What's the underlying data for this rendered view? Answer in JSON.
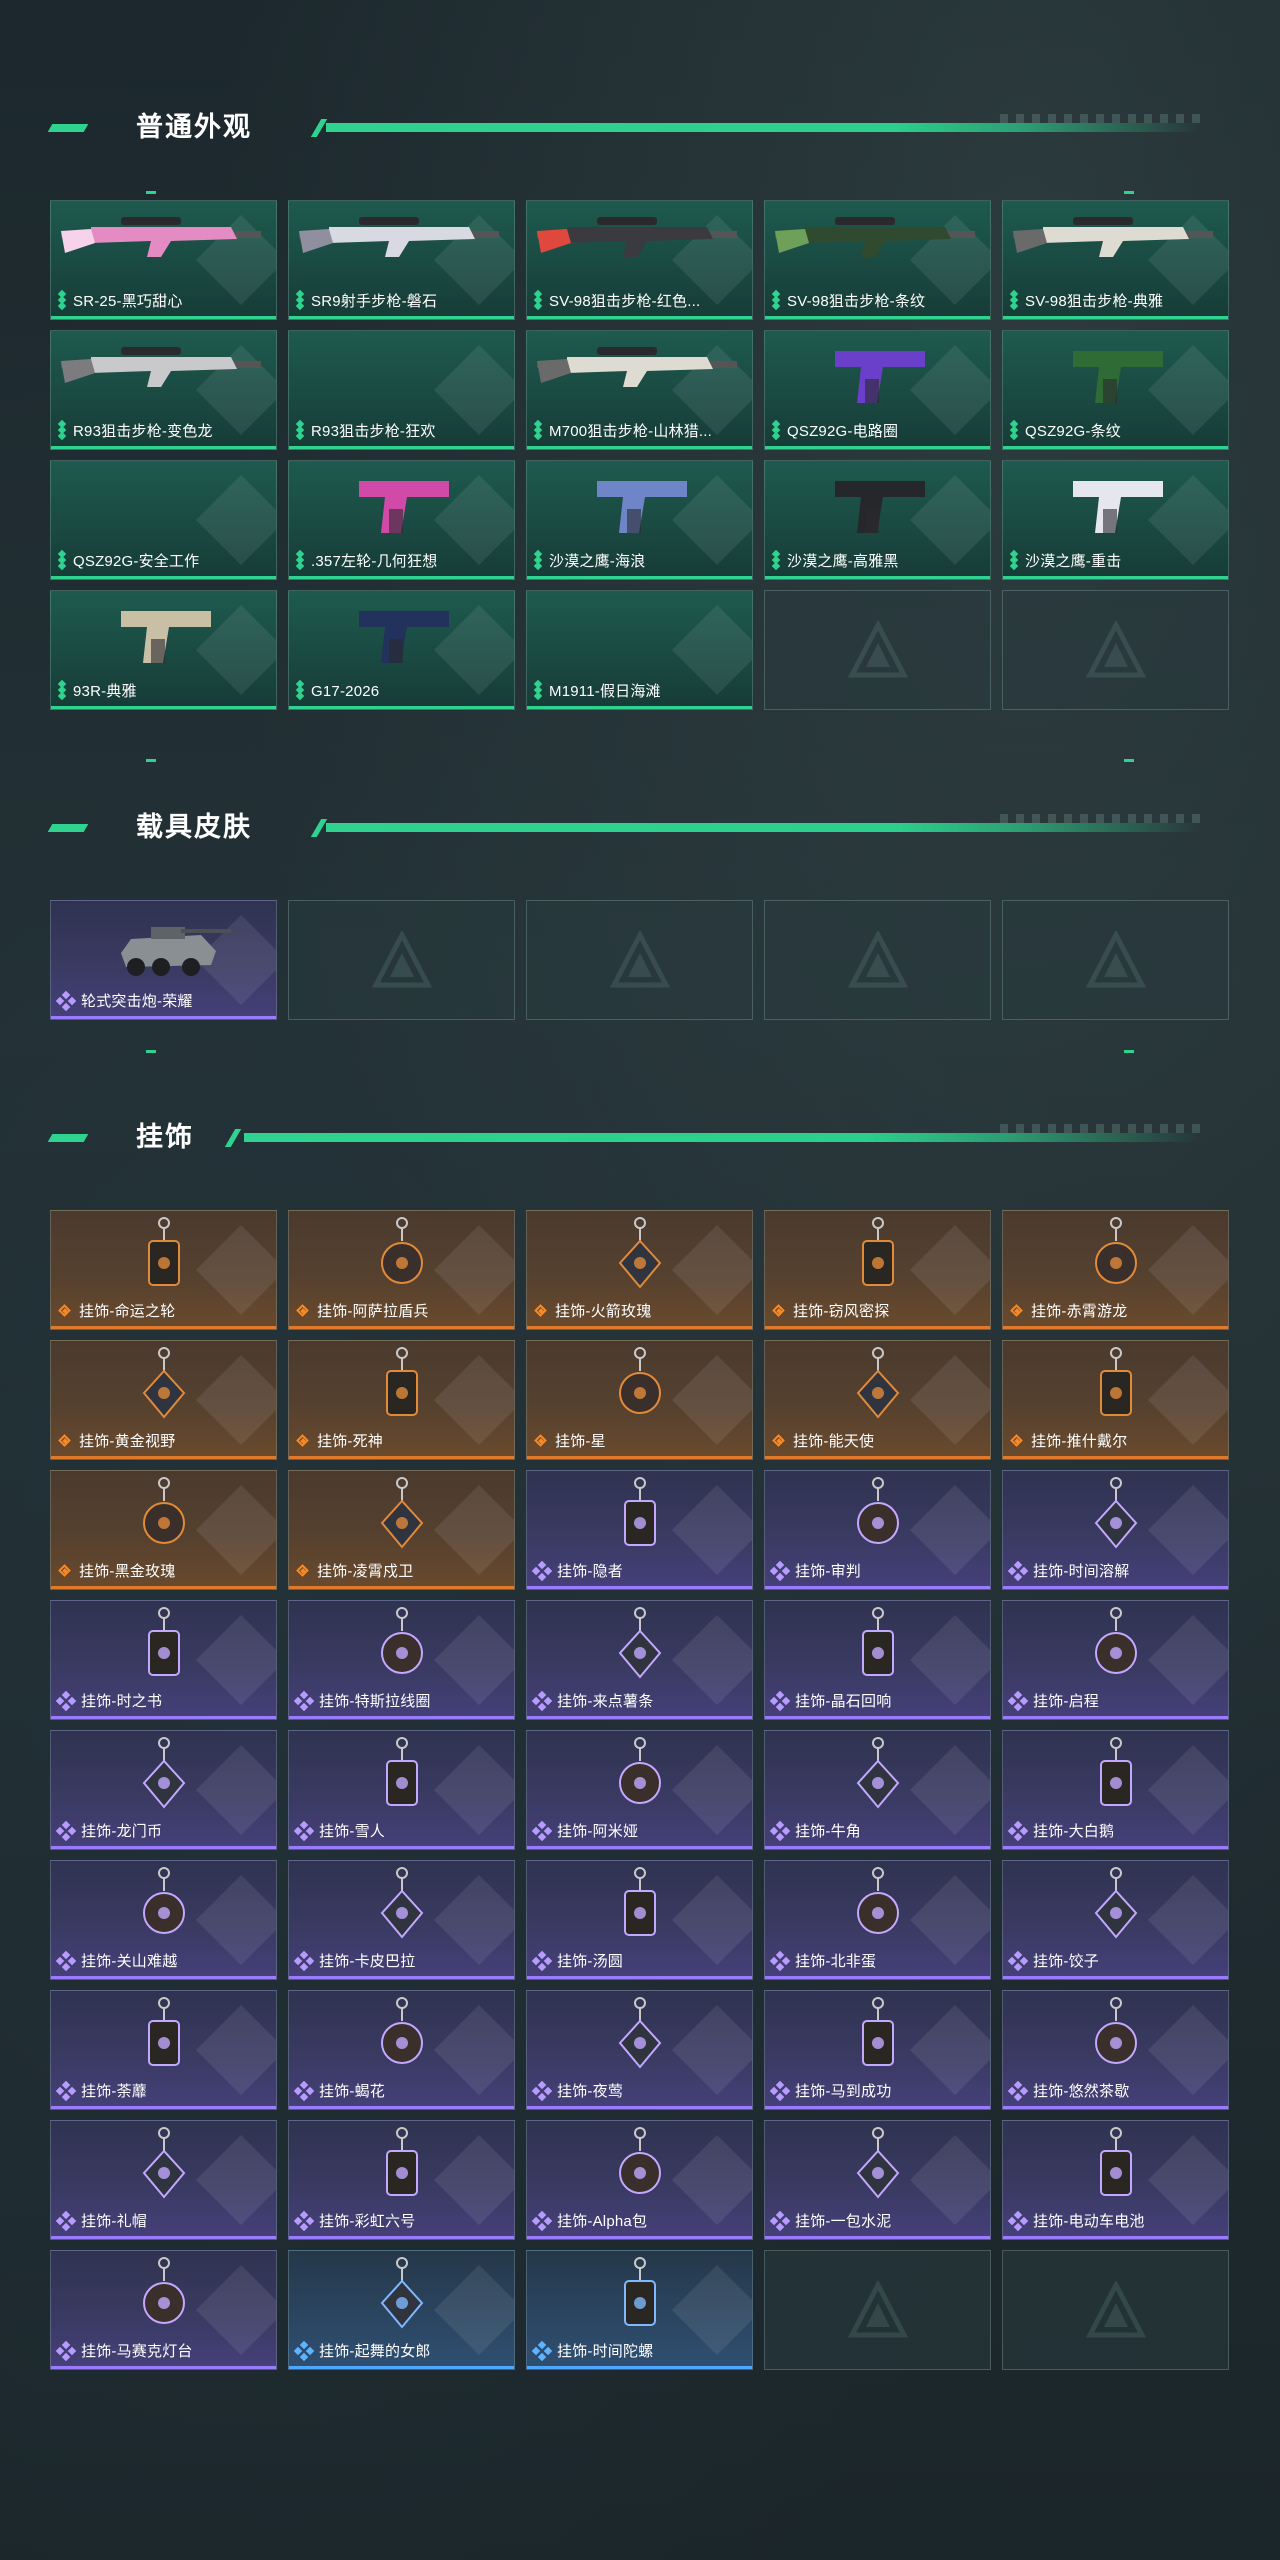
{
  "sections": {
    "weapons": {
      "title": "普通外观",
      "items": [
        {
          "label": "SR-25-黑巧甜心",
          "rarity": "green",
          "icon": "rifle-pink"
        },
        {
          "label": "SR9射手步枪-磐石",
          "rarity": "green",
          "icon": "rifle-white"
        },
        {
          "label": "SV-98狙击步枪-红色...",
          "rarity": "green",
          "icon": "sniper-red"
        },
        {
          "label": "SV-98狙击步枪-条纹",
          "rarity": "green",
          "icon": "sniper-green"
        },
        {
          "label": "SV-98狙击步枪-典雅",
          "rarity": "green",
          "icon": "sniper-white"
        },
        {
          "label": "R93狙击步枪-变色龙",
          "rarity": "green",
          "icon": "sniper-grey"
        },
        {
          "label": "R93狙击步枪-狂欢",
          "rarity": "green",
          "icon": ""
        },
        {
          "label": "M700狙击步枪-山林猎...",
          "rarity": "green",
          "icon": "sniper-white"
        },
        {
          "label": "QSZ92G-电路圈",
          "rarity": "green",
          "icon": "pistol-purple"
        },
        {
          "label": "QSZ92G-条纹",
          "rarity": "green",
          "icon": "pistol-green"
        },
        {
          "label": "QSZ92G-安全工作",
          "rarity": "green",
          "icon": ""
        },
        {
          "label": ".357左轮-几何狂想",
          "rarity": "green",
          "icon": "revolver-pink"
        },
        {
          "label": "沙漠之鹰-海浪",
          "rarity": "green",
          "icon": "pistol-blue"
        },
        {
          "label": "沙漠之鹰-高雅黑",
          "rarity": "green",
          "icon": "pistol-black"
        },
        {
          "label": "沙漠之鹰-重击",
          "rarity": "green",
          "icon": "pistol-white"
        },
        {
          "label": "93R-典雅",
          "rarity": "green",
          "icon": "pistol-beige"
        },
        {
          "label": "G17-2026",
          "rarity": "green",
          "icon": "pistol-navy"
        },
        {
          "label": "M1911-假日海滩",
          "rarity": "green",
          "icon": ""
        }
      ],
      "empty_slots": 2
    },
    "vehicles": {
      "title": "载具皮肤",
      "items": [
        {
          "label": "轮式突击炮-荣耀",
          "rarity": "purple",
          "icon": "vehicle"
        }
      ],
      "empty_slots": 4
    },
    "charms": {
      "title": "挂饰",
      "items": [
        {
          "label": "挂饰-命运之轮",
          "rarity": "orange"
        },
        {
          "label": "挂饰-阿萨拉盾兵",
          "rarity": "orange"
        },
        {
          "label": "挂饰-火箭玫瑰",
          "rarity": "orange"
        },
        {
          "label": "挂饰-窃风密探",
          "rarity": "orange"
        },
        {
          "label": "挂饰-赤霄游龙",
          "rarity": "orange"
        },
        {
          "label": "挂饰-黄金视野",
          "rarity": "orange"
        },
        {
          "label": "挂饰-死神",
          "rarity": "orange"
        },
        {
          "label": "挂饰-星",
          "rarity": "orange"
        },
        {
          "label": "挂饰-能天使",
          "rarity": "orange"
        },
        {
          "label": "挂饰-推什戴尔",
          "rarity": "orange"
        },
        {
          "label": "挂饰-黑金玫瑰",
          "rarity": "orange"
        },
        {
          "label": "挂饰-凌霄戍卫",
          "rarity": "orange"
        },
        {
          "label": "挂饰-隐者",
          "rarity": "purple"
        },
        {
          "label": "挂饰-审判",
          "rarity": "purple"
        },
        {
          "label": "挂饰-时间溶解",
          "rarity": "purple"
        },
        {
          "label": "挂饰-时之书",
          "rarity": "purple"
        },
        {
          "label": "挂饰-特斯拉线圈",
          "rarity": "purple"
        },
        {
          "label": "挂饰-来点薯条",
          "rarity": "purple"
        },
        {
          "label": "挂饰-晶石回响",
          "rarity": "purple"
        },
        {
          "label": "挂饰-启程",
          "rarity": "purple"
        },
        {
          "label": "挂饰-龙门币",
          "rarity": "purple"
        },
        {
          "label": "挂饰-雪人",
          "rarity": "purple"
        },
        {
          "label": "挂饰-阿米娅",
          "rarity": "purple"
        },
        {
          "label": "挂饰-牛角",
          "rarity": "purple"
        },
        {
          "label": "挂饰-大白鹅",
          "rarity": "purple"
        },
        {
          "label": "挂饰-关山难越",
          "rarity": "purple"
        },
        {
          "label": "挂饰-卡皮巴拉",
          "rarity": "purple"
        },
        {
          "label": "挂饰-汤圆",
          "rarity": "purple"
        },
        {
          "label": "挂饰-北非蛋",
          "rarity": "purple"
        },
        {
          "label": "挂饰-饺子",
          "rarity": "purple"
        },
        {
          "label": "挂饰-荼蘼",
          "rarity": "purple"
        },
        {
          "label": "挂饰-蝎花",
          "rarity": "purple"
        },
        {
          "label": "挂饰-夜莺",
          "rarity": "purple"
        },
        {
          "label": "挂饰-马到成功",
          "rarity": "purple"
        },
        {
          "label": "挂饰-悠然茶歇",
          "rarity": "purple"
        },
        {
          "label": "挂饰-礼帽",
          "rarity": "purple"
        },
        {
          "label": "挂饰-彩虹六号",
          "rarity": "purple"
        },
        {
          "label": "挂饰-Alpha包",
          "rarity": "purple"
        },
        {
          "label": "挂饰-一包水泥",
          "rarity": "purple"
        },
        {
          "label": "挂饰-电动车电池",
          "rarity": "purple"
        },
        {
          "label": "挂饰-马赛克灯台",
          "rarity": "purple"
        },
        {
          "label": "挂饰-起舞的女郎",
          "rarity": "blue"
        },
        {
          "label": "挂饰-时间陀螺",
          "rarity": "blue"
        }
      ],
      "empty_slots": 2
    }
  },
  "colors": {
    "accent_green": "#2fd38f",
    "rarity_orange": "#e07a2a",
    "rarity_purple": "#9a7bff",
    "rarity_blue": "#4da6ff",
    "background": "#1e2a2f"
  }
}
